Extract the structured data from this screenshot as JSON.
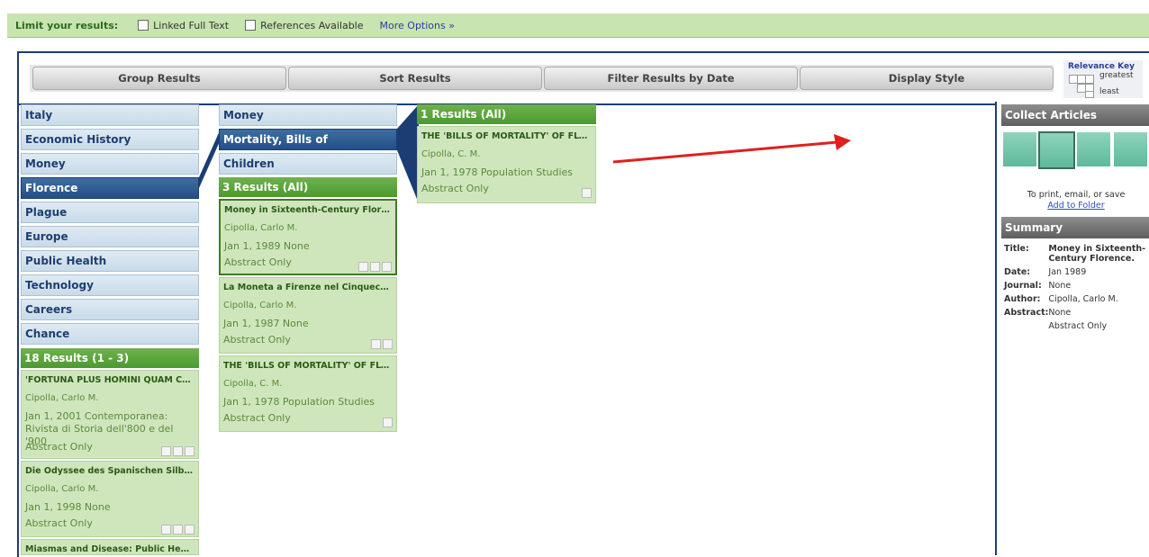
{
  "limit_bar": {
    "label": "Limit your results:",
    "option1": "Linked Full Text",
    "option2": "References Available",
    "more": "More Options »"
  },
  "toolbar": {
    "group": "Group Results",
    "sort": "Sort Results",
    "filter": "Filter Results by Date",
    "display": "Display Style"
  },
  "relevance_key": {
    "title": "Relevance Key",
    "greatest": "greatest",
    "least": "least"
  },
  "col1": {
    "topics": [
      "Italy",
      "Economic History",
      "Money",
      "Florence",
      "Plague",
      "Europe",
      "Public Health",
      "Technology",
      "Careers",
      "Chance"
    ],
    "selected_index": 3,
    "results_header": "18 Results (1 - 3)",
    "cards": [
      {
        "title": "'FORTUNA PLUS HOMINI QUAM CONSI...",
        "author": "Cipolla, Carlo M.",
        "date": "Jan 1, 2001 Contemporanea: Rivista di Storia dell'800 e del '900",
        "access": "Abstract Only"
      },
      {
        "title": "Die Odyssee des Spanischen Silbers: Co...",
        "author": "Cipolla, Carlo M.",
        "date": "Jan 1, 1998 None",
        "access": "Abstract Only"
      },
      {
        "title": "Miasmas and Disease: Public Health an..."
      }
    ]
  },
  "col2": {
    "topics": [
      "Money",
      "Mortality, Bills of",
      "Children"
    ],
    "selected_index": 1,
    "results_header": "3 Results (All)",
    "cards": [
      {
        "title": "Money in Sixteenth-Century Florence.",
        "author": "Cipolla, Carlo M.",
        "date": "Jan 1, 1989 None",
        "access": "Abstract Only"
      },
      {
        "title": "La Moneta a Firenze nel Cinquecento.",
        "author": "Cipolla, Carlo M.",
        "date": "Jan 1, 1987 None",
        "access": "Abstract Only"
      },
      {
        "title": "THE 'BILLS OF MORTALITY' OF FLORENCE.",
        "author": "Cipolla, C. M.",
        "date": "Jan 1, 1978 Population Studies",
        "access": "Abstract Only"
      }
    ]
  },
  "col3": {
    "results_header": "1 Results (All)",
    "cards": [
      {
        "title": "THE 'BILLS OF MORTALITY' OF FLORENCE.",
        "author": "Cipolla, C. M.",
        "date": "Jan 1, 1978 Population Studies",
        "access": "Abstract Only"
      }
    ]
  },
  "collect": {
    "header": "Collect Articles",
    "note": "To print, email, or save",
    "link": "Add to Folder"
  },
  "summary": {
    "header": "Summary",
    "title_label": "Title:",
    "title": "Money in Sixteenth-Century Florence.",
    "date_label": "Date:",
    "date": "Jan 1989",
    "journal_label": "Journal:",
    "journal": "None",
    "author_label": "Author:",
    "author": "Cipolla, Carlo M.",
    "abstract_label": "Abstract:",
    "abstract": "None",
    "access": "Abstract Only"
  },
  "colors": {
    "accent_green": "#4b9a2f",
    "nav_blue": "#234f86",
    "arrow": "#e02020"
  }
}
